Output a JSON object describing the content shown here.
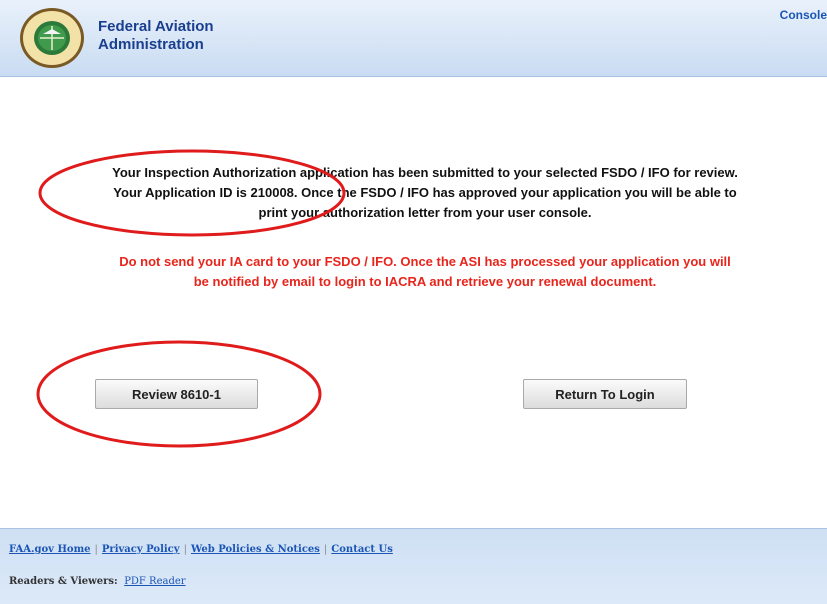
{
  "header": {
    "title_line1": "Federal Aviation",
    "title_line2": "Administration",
    "console_link": "Console",
    "seal_text": "FEDERAL AVIATION ADMINISTRATION"
  },
  "confirmation": {
    "line1": "Your Inspection Authorization application has been submitted to your selected FSDO / IFO for review.",
    "line2": "Your Application ID is 210008. Once the FSDO / IFO has approved your application you will be able to",
    "line3": "print your authorization letter from your user console."
  },
  "warning": {
    "line1": "Do not send your IA card to your FSDO / IFO. Once the ASI has processed your application you will",
    "line2": "be notified by email to login to IACRA and retrieve your renewal document."
  },
  "buttons": {
    "review": "Review 8610-1",
    "return_login": "Return To Login"
  },
  "footer": {
    "links": [
      "FAA.gov Home",
      "Privacy Policy",
      "Web Policies & Notices",
      "Contact Us"
    ],
    "readers_label": "Readers & Viewers:",
    "pdf_reader": "PDF Reader"
  },
  "colors": {
    "header_bg": "#c9dcf2",
    "title": "#1b3f8f",
    "warning": "#e8251c",
    "annotation": "#e01b1b",
    "link": "#1b55b5"
  }
}
